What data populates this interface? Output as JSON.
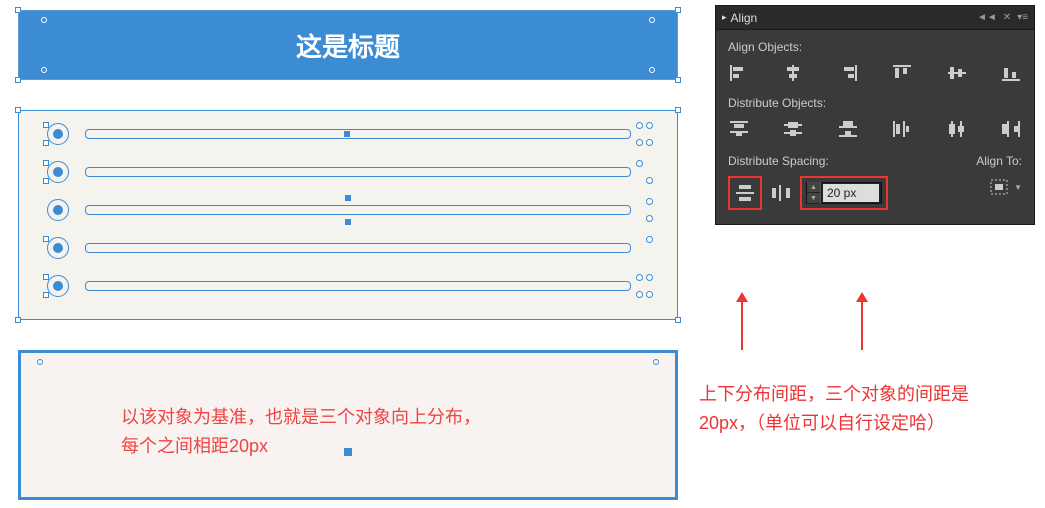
{
  "header": {
    "title": "这是标题"
  },
  "bottom_annotation": {
    "line1": "以该对象为基准，也就是三个对象向上分布，",
    "line2": "每个之间相距20px"
  },
  "align_panel": {
    "title": "Align",
    "align_objects_label": "Align Objects:",
    "distribute_objects_label": "Distribute Objects:",
    "distribute_spacing_label": "Distribute Spacing:",
    "align_to_label": "Align To:",
    "spacing_value": "20 px"
  },
  "right_annotation": {
    "line1": "上下分布间距，三个对象的间距是",
    "line2": "20px，（单位可以自行设定哈）"
  }
}
